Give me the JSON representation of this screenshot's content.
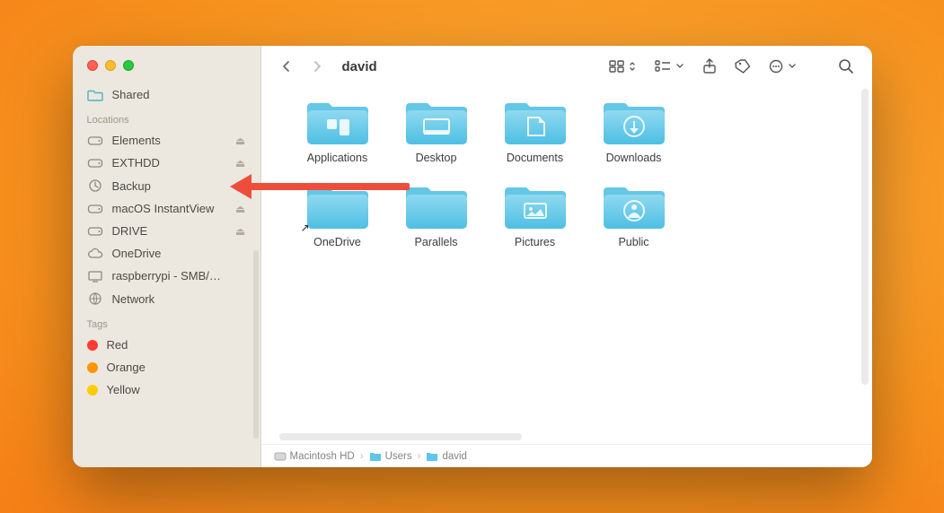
{
  "window": {
    "title": "david"
  },
  "sidebar": {
    "shared_label": "Shared",
    "locations_header": "Locations",
    "locations": [
      {
        "label": "Elements",
        "icon": "disk",
        "trail": "eject"
      },
      {
        "label": "EXTHDD",
        "icon": "disk",
        "trail": "eject"
      },
      {
        "label": "Backup",
        "icon": "time",
        "trail": "sync"
      },
      {
        "label": "macOS InstantView",
        "icon": "disk",
        "trail": "eject"
      },
      {
        "label": "DRIVE",
        "icon": "disk",
        "trail": "eject"
      },
      {
        "label": "OneDrive",
        "icon": "cloud",
        "trail": ""
      },
      {
        "label": "raspberrypi - SMB/CIFS",
        "icon": "screen",
        "trail": ""
      },
      {
        "label": "Network",
        "icon": "globe",
        "trail": ""
      }
    ],
    "tags_header": "Tags",
    "tags": [
      {
        "label": "Red",
        "color": "red"
      },
      {
        "label": "Orange",
        "color": "orange"
      },
      {
        "label": "Yellow",
        "color": "yellow"
      }
    ]
  },
  "folders": [
    {
      "name": "Applications",
      "glyph": "apps"
    },
    {
      "name": "Desktop",
      "glyph": "desktop"
    },
    {
      "name": "Documents",
      "glyph": "doc"
    },
    {
      "name": "Downloads",
      "glyph": "download"
    },
    {
      "name": "OneDrive",
      "glyph": "plain",
      "alias": true
    },
    {
      "name": "Parallels",
      "glyph": "plain"
    },
    {
      "name": "Pictures",
      "glyph": "picture"
    },
    {
      "name": "Public",
      "glyph": "public"
    }
  ],
  "pathbar": [
    "Macintosh HD",
    "Users",
    "david"
  ],
  "annotation": {
    "arrow": true
  }
}
